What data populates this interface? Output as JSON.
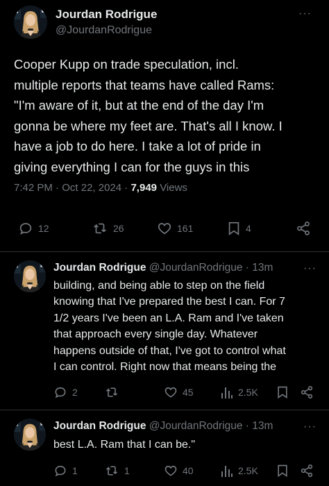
{
  "main_tweet": {
    "author_name": "Jourdan Rodrigue",
    "author_handle": "@JourdanRodrigue",
    "text": "Cooper Kupp on trade speculation, incl.\nmultiple reports that teams have called Rams:\n\"I'm aware of it, but at the end of the day I'm\ngonna be where my feet are. That's all I know. I\nhave a job to do here. I take a lot of pride in\ngiving everything I can for the guys in this",
    "time": "7:42 PM",
    "date": "Oct 22, 2024",
    "views_count": "7,949",
    "views_label": "Views",
    "stats": {
      "replies": "12",
      "reposts": "26",
      "likes": "161",
      "bookmarks": "4"
    }
  },
  "replies": [
    {
      "author_name": "Jourdan Rodrigue",
      "author_handle": "@JourdanRodrigue",
      "time": "13m",
      "text": "building, and being able to step on the field\nknowing that I've prepared the best I can. For 7\n1/2 years I've been an L.A. Ram and I've taken\nthat approach every single day. Whatever\nhappens outside of that, I've got to control what\nI can control. Right now that means being the",
      "stats": {
        "replies": "2",
        "reposts": "",
        "likes": "45",
        "views": "2.5K"
      }
    },
    {
      "author_name": "Jourdan Rodrigue",
      "author_handle": "@JourdanRodrigue",
      "time": "13m",
      "text": "best L.A. Ram that I can be.\"",
      "stats": {
        "replies": "1",
        "reposts": "1",
        "likes": "40",
        "views": "2.5K"
      }
    }
  ],
  "ui": {
    "dot": "·",
    "more_glyph": "···"
  },
  "colors": {
    "background": "#000000",
    "text": "#e7e9ea",
    "secondary": "#71767b",
    "divider": "#2f3336"
  }
}
